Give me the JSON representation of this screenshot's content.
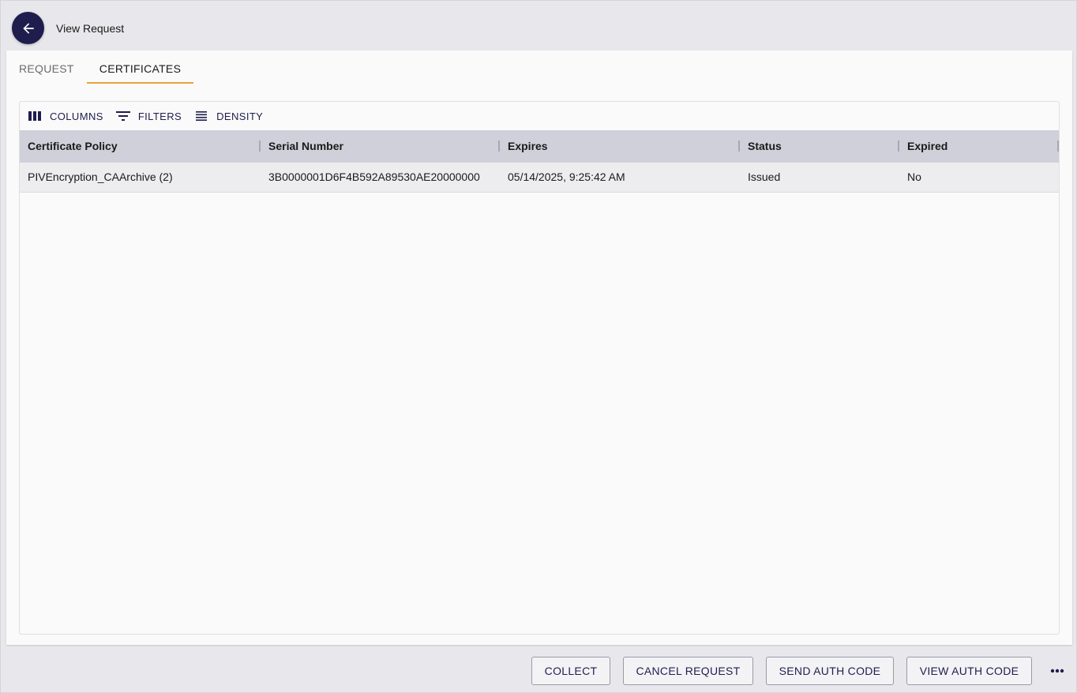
{
  "header": {
    "title": "View Request",
    "back_icon": "arrow-left-icon"
  },
  "tabs": [
    {
      "label": "REQUEST",
      "active": false
    },
    {
      "label": "CERTIFICATES",
      "active": true
    }
  ],
  "toolbar": {
    "columns_label": "COLUMNS",
    "filters_label": "FILTERS",
    "density_label": "DENSITY"
  },
  "table": {
    "columns": [
      "Certificate Policy",
      "Serial Number",
      "Expires",
      "Status",
      "Expired"
    ],
    "rows": [
      [
        "PIVEncryption_CAArchive (2)",
        "3B0000001D6F4B592A89530AE20000000",
        "05/14/2025, 9:25:42 AM",
        "Issued",
        "No"
      ]
    ]
  },
  "footer": {
    "collect_label": "COLLECT",
    "cancel_label": "CANCEL REQUEST",
    "send_auth_label": "SEND AUTH CODE",
    "view_auth_label": "VIEW AUTH CODE",
    "more_icon": "more-horizontal-icon"
  },
  "colors": {
    "primary": "#1f1d4e",
    "tab_indicator": "#e8a33d",
    "header_bg": "#d0d0da"
  }
}
